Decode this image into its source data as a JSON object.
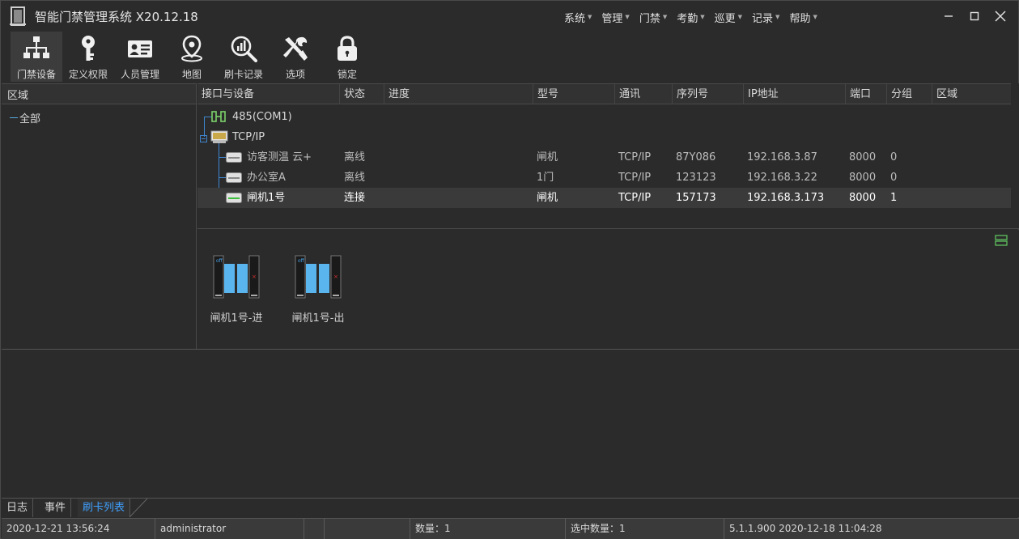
{
  "window": {
    "title": "智能门禁管理系统 X20.12.18"
  },
  "menu": [
    {
      "label": "系统"
    },
    {
      "label": "管理"
    },
    {
      "label": "门禁"
    },
    {
      "label": "考勤"
    },
    {
      "label": "巡更"
    },
    {
      "label": "记录"
    },
    {
      "label": "帮助"
    }
  ],
  "toolbar": [
    {
      "label": "门禁设备",
      "icon": "network-tree-icon",
      "active": true
    },
    {
      "label": "定义权限",
      "icon": "key-icon"
    },
    {
      "label": "人员管理",
      "icon": "id-card-icon"
    },
    {
      "label": "地图",
      "icon": "map-pin-icon"
    },
    {
      "label": "刷卡记录",
      "icon": "chart-search-icon"
    },
    {
      "label": "选项",
      "icon": "tools-icon"
    },
    {
      "label": "锁定",
      "icon": "lock-icon"
    }
  ],
  "area_pane": {
    "header": "区域",
    "items": [
      {
        "label": "全部"
      }
    ]
  },
  "grid": {
    "columns": [
      "接口与设备",
      "状态",
      "进度",
      "型号",
      "通讯",
      "序列号",
      "IP地址",
      "端口",
      "分组",
      "区域"
    ],
    "groups": [
      {
        "label": "485(COM1)"
      },
      {
        "label": "TCP/IP"
      }
    ],
    "rows": [
      {
        "name": "访客测温 云+",
        "status": "离线",
        "progress": "",
        "model": "闸机",
        "comm": "TCP/IP",
        "serial": "87Y086",
        "ip": "192.168.3.87",
        "port": "8000",
        "group": "0",
        "area": ""
      },
      {
        "name": "办公室A",
        "status": "离线",
        "progress": "",
        "model": "1门",
        "comm": "TCP/IP",
        "serial": "123123",
        "ip": "192.168.3.22",
        "port": "8000",
        "group": "0",
        "area": ""
      },
      {
        "name": "闸机1号",
        "status": "连接",
        "progress": "",
        "model": "闸机",
        "comm": "TCP/IP",
        "serial": "157173",
        "ip": "192.168.3.173",
        "port": "8000",
        "group": "1",
        "area": "",
        "selected": true
      }
    ]
  },
  "doors": [
    {
      "label": "闸机1号-进"
    },
    {
      "label": "闸机1号-出"
    }
  ],
  "tabs": [
    {
      "label": "日志"
    },
    {
      "label": "事件"
    },
    {
      "label": "刷卡列表",
      "active": true
    }
  ],
  "statusbar": {
    "datetime": "2020-12-21 13:56:24",
    "user": "administrator",
    "count": "数量：1",
    "selected_count": "选中数量：1",
    "version": "5.1.1.900  2020-12-18 11:04:28"
  },
  "colors": {
    "accent": "#3fa0ff",
    "online": "#4ce04c",
    "background": "#2b2b2b"
  }
}
